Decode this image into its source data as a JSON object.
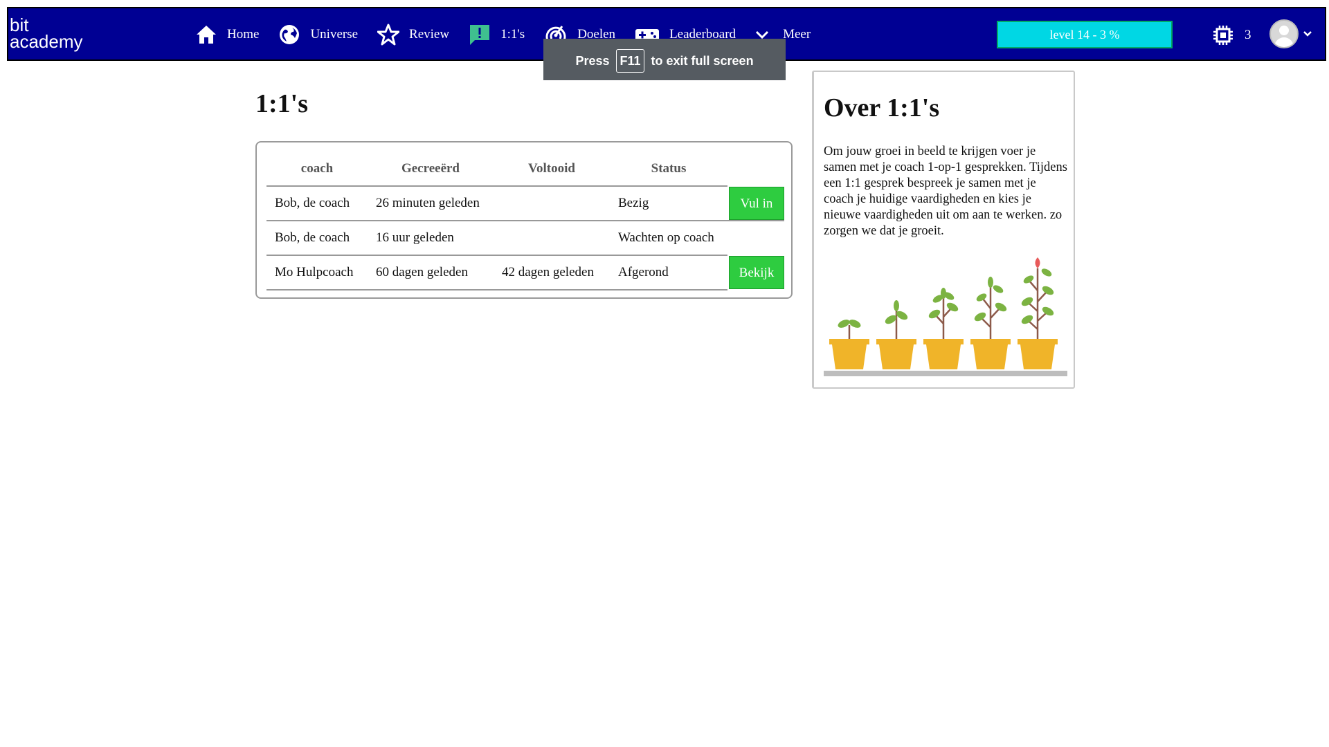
{
  "brand": {
    "line1": "bit",
    "line2": "academy"
  },
  "nav": {
    "items": [
      {
        "label": "Home",
        "icon": "home-icon"
      },
      {
        "label": "Universe",
        "icon": "globe-icon"
      },
      {
        "label": "Review",
        "icon": "star-icon"
      },
      {
        "label": "1:1's",
        "icon": "chat-alert-icon"
      },
      {
        "label": "Doelen",
        "icon": "target-icon"
      },
      {
        "label": "Leaderboard",
        "icon": "gamepad-icon"
      },
      {
        "label": "Meer",
        "icon": "chevron-down-icon"
      }
    ],
    "level": "level 14 - 3 %",
    "chip_count": "3"
  },
  "toast": {
    "before": "Press",
    "key": "F11",
    "after": "to exit full screen"
  },
  "main": {
    "title": "1:1's",
    "table": {
      "headers": [
        "coach",
        "Gecreeërd",
        "Voltooid",
        "Status"
      ],
      "rows": [
        {
          "coach": "Bob, de coach",
          "created": "26 minuten geleden",
          "completed": "",
          "status": "Bezig",
          "action": "Vul in"
        },
        {
          "coach": "Bob, de coach",
          "created": "16 uur geleden",
          "completed": "",
          "status": "Wachten op coach",
          "action": ""
        },
        {
          "coach": "Mo Hulpcoach",
          "created": "60 dagen geleden",
          "completed": "42 dagen geleden",
          "status": "Afgerond",
          "action": "Bekijk"
        }
      ]
    }
  },
  "side": {
    "title": "Over 1:1's",
    "text": "Om jouw groei in beeld te krijgen voer je samen met je coach 1-op-1 gesprekken. Tijdens een 1:1 gesprek bespreek je samen met je coach je huidige vaardigheden en kies je nieuwe vaardigheden uit om aan te werken. zo zorgen we dat je groeit."
  },
  "colors": {
    "nav_bg": "#000093",
    "level_bg": "#00d7e4",
    "button_green": "#2ecc40",
    "pot": "#f0b429",
    "leaf": "#7cb342"
  }
}
